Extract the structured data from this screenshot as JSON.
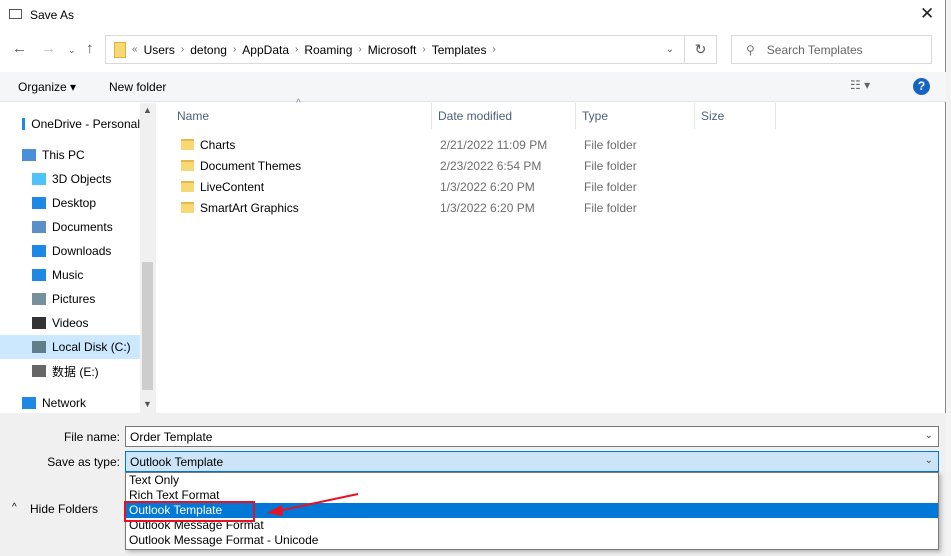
{
  "window": {
    "title": "Save As"
  },
  "address": {
    "overflow": "«",
    "crumbs": [
      "Users",
      "detong",
      "AppData",
      "Roaming",
      "Microsoft",
      "Templates"
    ]
  },
  "search": {
    "placeholder": "Search Templates"
  },
  "toolbar": {
    "organize": "Organize ▾",
    "new_folder": "New folder"
  },
  "nav": [
    {
      "label": "OneDrive - Personal",
      "icon": "cloud-icon"
    },
    {
      "label": "This PC",
      "icon": "computer-icon"
    },
    {
      "label": "3D Objects",
      "icon": "cube-icon"
    },
    {
      "label": "Desktop",
      "icon": "desktop-icon"
    },
    {
      "label": "Documents",
      "icon": "documents-icon"
    },
    {
      "label": "Downloads",
      "icon": "download-icon"
    },
    {
      "label": "Music",
      "icon": "music-icon"
    },
    {
      "label": "Pictures",
      "icon": "pictures-icon"
    },
    {
      "label": "Videos",
      "icon": "videos-icon"
    },
    {
      "label": "Local Disk (C:)",
      "icon": "disk-icon"
    },
    {
      "label": "数据 (E:)",
      "icon": "disk-icon"
    },
    {
      "label": "Network",
      "icon": "network-icon"
    }
  ],
  "columns": {
    "name": "Name",
    "date": "Date modified",
    "type": "Type",
    "size": "Size"
  },
  "files": [
    {
      "name": "Charts",
      "date": "2/21/2022 11:09 PM",
      "type": "File folder"
    },
    {
      "name": "Document Themes",
      "date": "2/23/2022 6:54 PM",
      "type": "File folder"
    },
    {
      "name": "LiveContent",
      "date": "1/3/2022 6:20 PM",
      "type": "File folder"
    },
    {
      "name": "SmartArt Graphics",
      "date": "1/3/2022 6:20 PM",
      "type": "File folder"
    }
  ],
  "form": {
    "file_name_label": "File name:",
    "file_name": "Order Template",
    "type_label": "Save as type:",
    "type_value": "Outlook Template",
    "hide_folders": "Hide Folders"
  },
  "type_options": [
    "Text Only",
    "Rich Text Format",
    "Outlook Template",
    "Outlook Message Format",
    "Outlook Message Format - Unicode"
  ],
  "colors": {
    "accent": "#0078d7",
    "highlight": "#e81123"
  }
}
